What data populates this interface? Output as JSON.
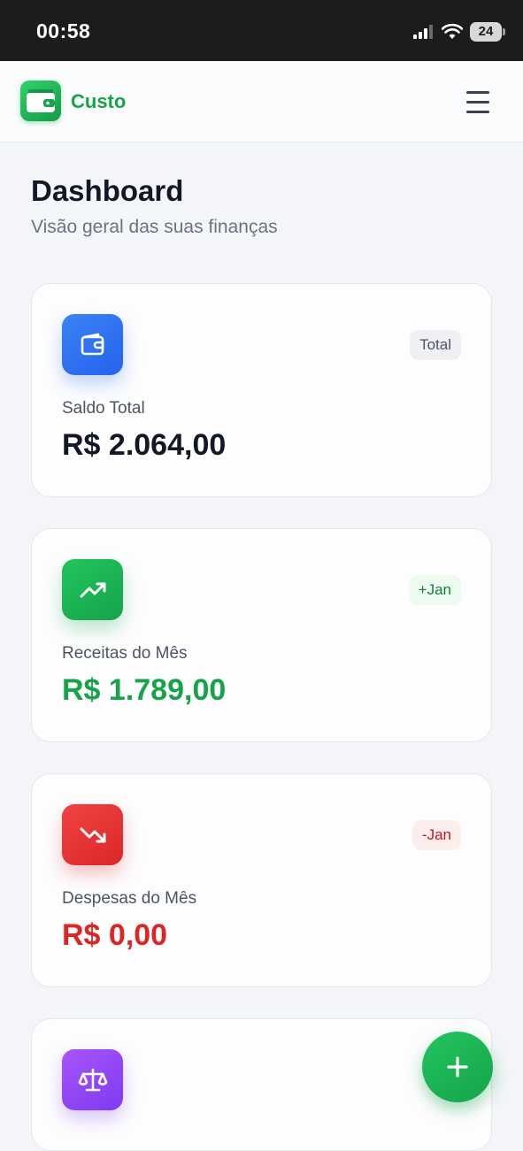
{
  "status_bar": {
    "time": "00:58",
    "battery": "24",
    "icons": [
      "cellular-signal-icon",
      "wifi-icon",
      "battery-icon"
    ]
  },
  "header": {
    "brand": "Custo",
    "logo_icon": "wallet-logo-icon",
    "menu_icon": "hamburger-menu-icon"
  },
  "page": {
    "title": "Dashboard",
    "subtitle": "Visão geral das suas finanças"
  },
  "cards": [
    {
      "icon": "wallet-icon",
      "badge": "Total",
      "label": "Saldo Total",
      "value": "R$ 2.064,00",
      "color": "#2563eb"
    },
    {
      "icon": "trending-up-icon",
      "badge": "+Jan",
      "label": "Receitas do Mês",
      "value": "R$ 1.789,00",
      "color": "#16a34a"
    },
    {
      "icon": "trending-down-icon",
      "badge": "-Jan",
      "label": "Despesas do Mês",
      "value": "R$ 0,00",
      "color": "#dc2626"
    },
    {
      "icon": "scale-icon",
      "color": "#7e3af2"
    }
  ],
  "fab": {
    "icon": "plus-icon",
    "color": "#16a34a"
  }
}
